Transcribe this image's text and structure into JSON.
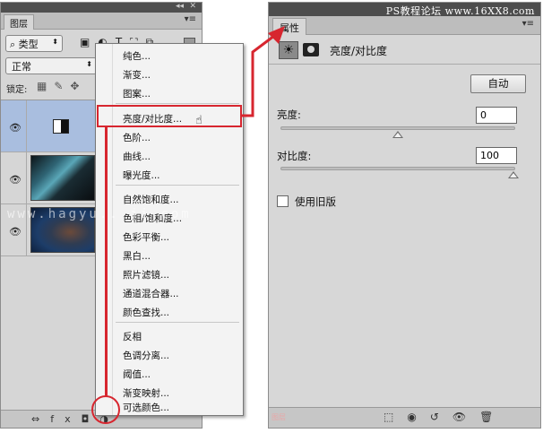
{
  "layers_panel": {
    "tab": "图层",
    "filter_label": "类型",
    "blend_mode": "正常",
    "lock_label": "锁定:"
  },
  "adjust_menu": {
    "items": [
      "纯色...",
      "渐变...",
      "图案...",
      "亮度/对比度...",
      "色阶...",
      "曲线...",
      "曝光度...",
      "自然饱和度...",
      "色相/饱和度...",
      "色彩平衡...",
      "黑白...",
      "照片滤镜...",
      "通道混合器...",
      "颜色查找...",
      "反相",
      "色调分离...",
      "阈值...",
      "渐变映射...",
      "可选颜色..."
    ],
    "highlighted": "亮度/对比度..."
  },
  "properties_panel": {
    "tab": "属性",
    "title": "亮度/对比度",
    "auto_button": "自动",
    "brightness_label": "亮度:",
    "brightness_value": "0",
    "contrast_label": "对比度:",
    "contrast_value": "100",
    "legacy_label": "使用旧版"
  },
  "watermarks": {
    "top_right": "PS教程论坛 www.16XX8.com",
    "middle": "www.hagyu...ji.com",
    "bottom": "图层"
  },
  "accent": "#d7262f"
}
